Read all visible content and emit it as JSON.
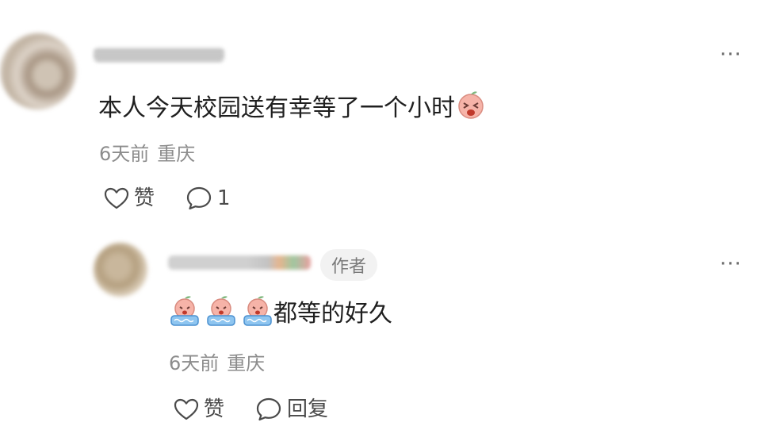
{
  "comment": {
    "text": "本人今天校园送有幸等了一个小时",
    "time": "6天前",
    "location": "重庆",
    "like_label": "赞",
    "reply_count": "1",
    "emoji": "crying-peach-emoji"
  },
  "reply": {
    "badge": "作者",
    "text": "都等的好久",
    "time": "6天前",
    "location": "重庆",
    "like_label": "赞",
    "reply_label": "回复",
    "emoji": "crying-peach-in-water-emoji"
  },
  "more_label": "···"
}
